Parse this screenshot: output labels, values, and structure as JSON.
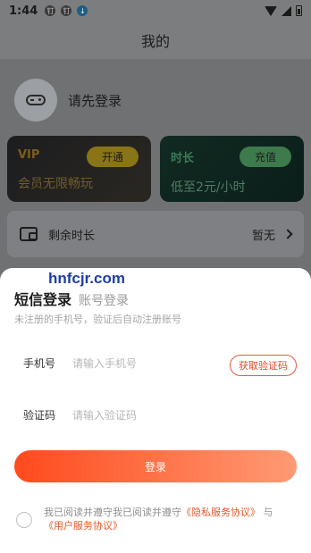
{
  "status_bar": {
    "time": "1:44",
    "notif1": "钉",
    "notif2": "钉"
  },
  "header": {
    "title": "我的"
  },
  "profile": {
    "login_prompt": "请先登录"
  },
  "vip_card": {
    "title": "VIP",
    "button": "开通",
    "subtitle": "会员无限畅玩"
  },
  "time_card": {
    "title": "时长",
    "button": "充值",
    "subtitle": "低至2元/小时"
  },
  "remaining": {
    "label": "剩余时长",
    "value": "暂无"
  },
  "sheet": {
    "watermark": "hnfcjr.com",
    "tab_sms": "短信登录",
    "tab_account": "账号登录",
    "hint": "未注册的手机号，验证后自动注册账号",
    "phone": {
      "label": "手机号",
      "placeholder": "请输入手机号",
      "value": ""
    },
    "get_code": "获取验证码",
    "code": {
      "label": "验证码",
      "placeholder": "请输入验证码",
      "value": ""
    },
    "login_button": "登录",
    "agreement": {
      "prefix": "我已阅读并遵守我已阅读并遵守",
      "privacy_link": "《隐私服务协议》",
      "and": " 与",
      "user_link": "《用户服务协议》"
    }
  },
  "colors": {
    "accent": "#ff4a1c",
    "link": "#e35a2e"
  }
}
